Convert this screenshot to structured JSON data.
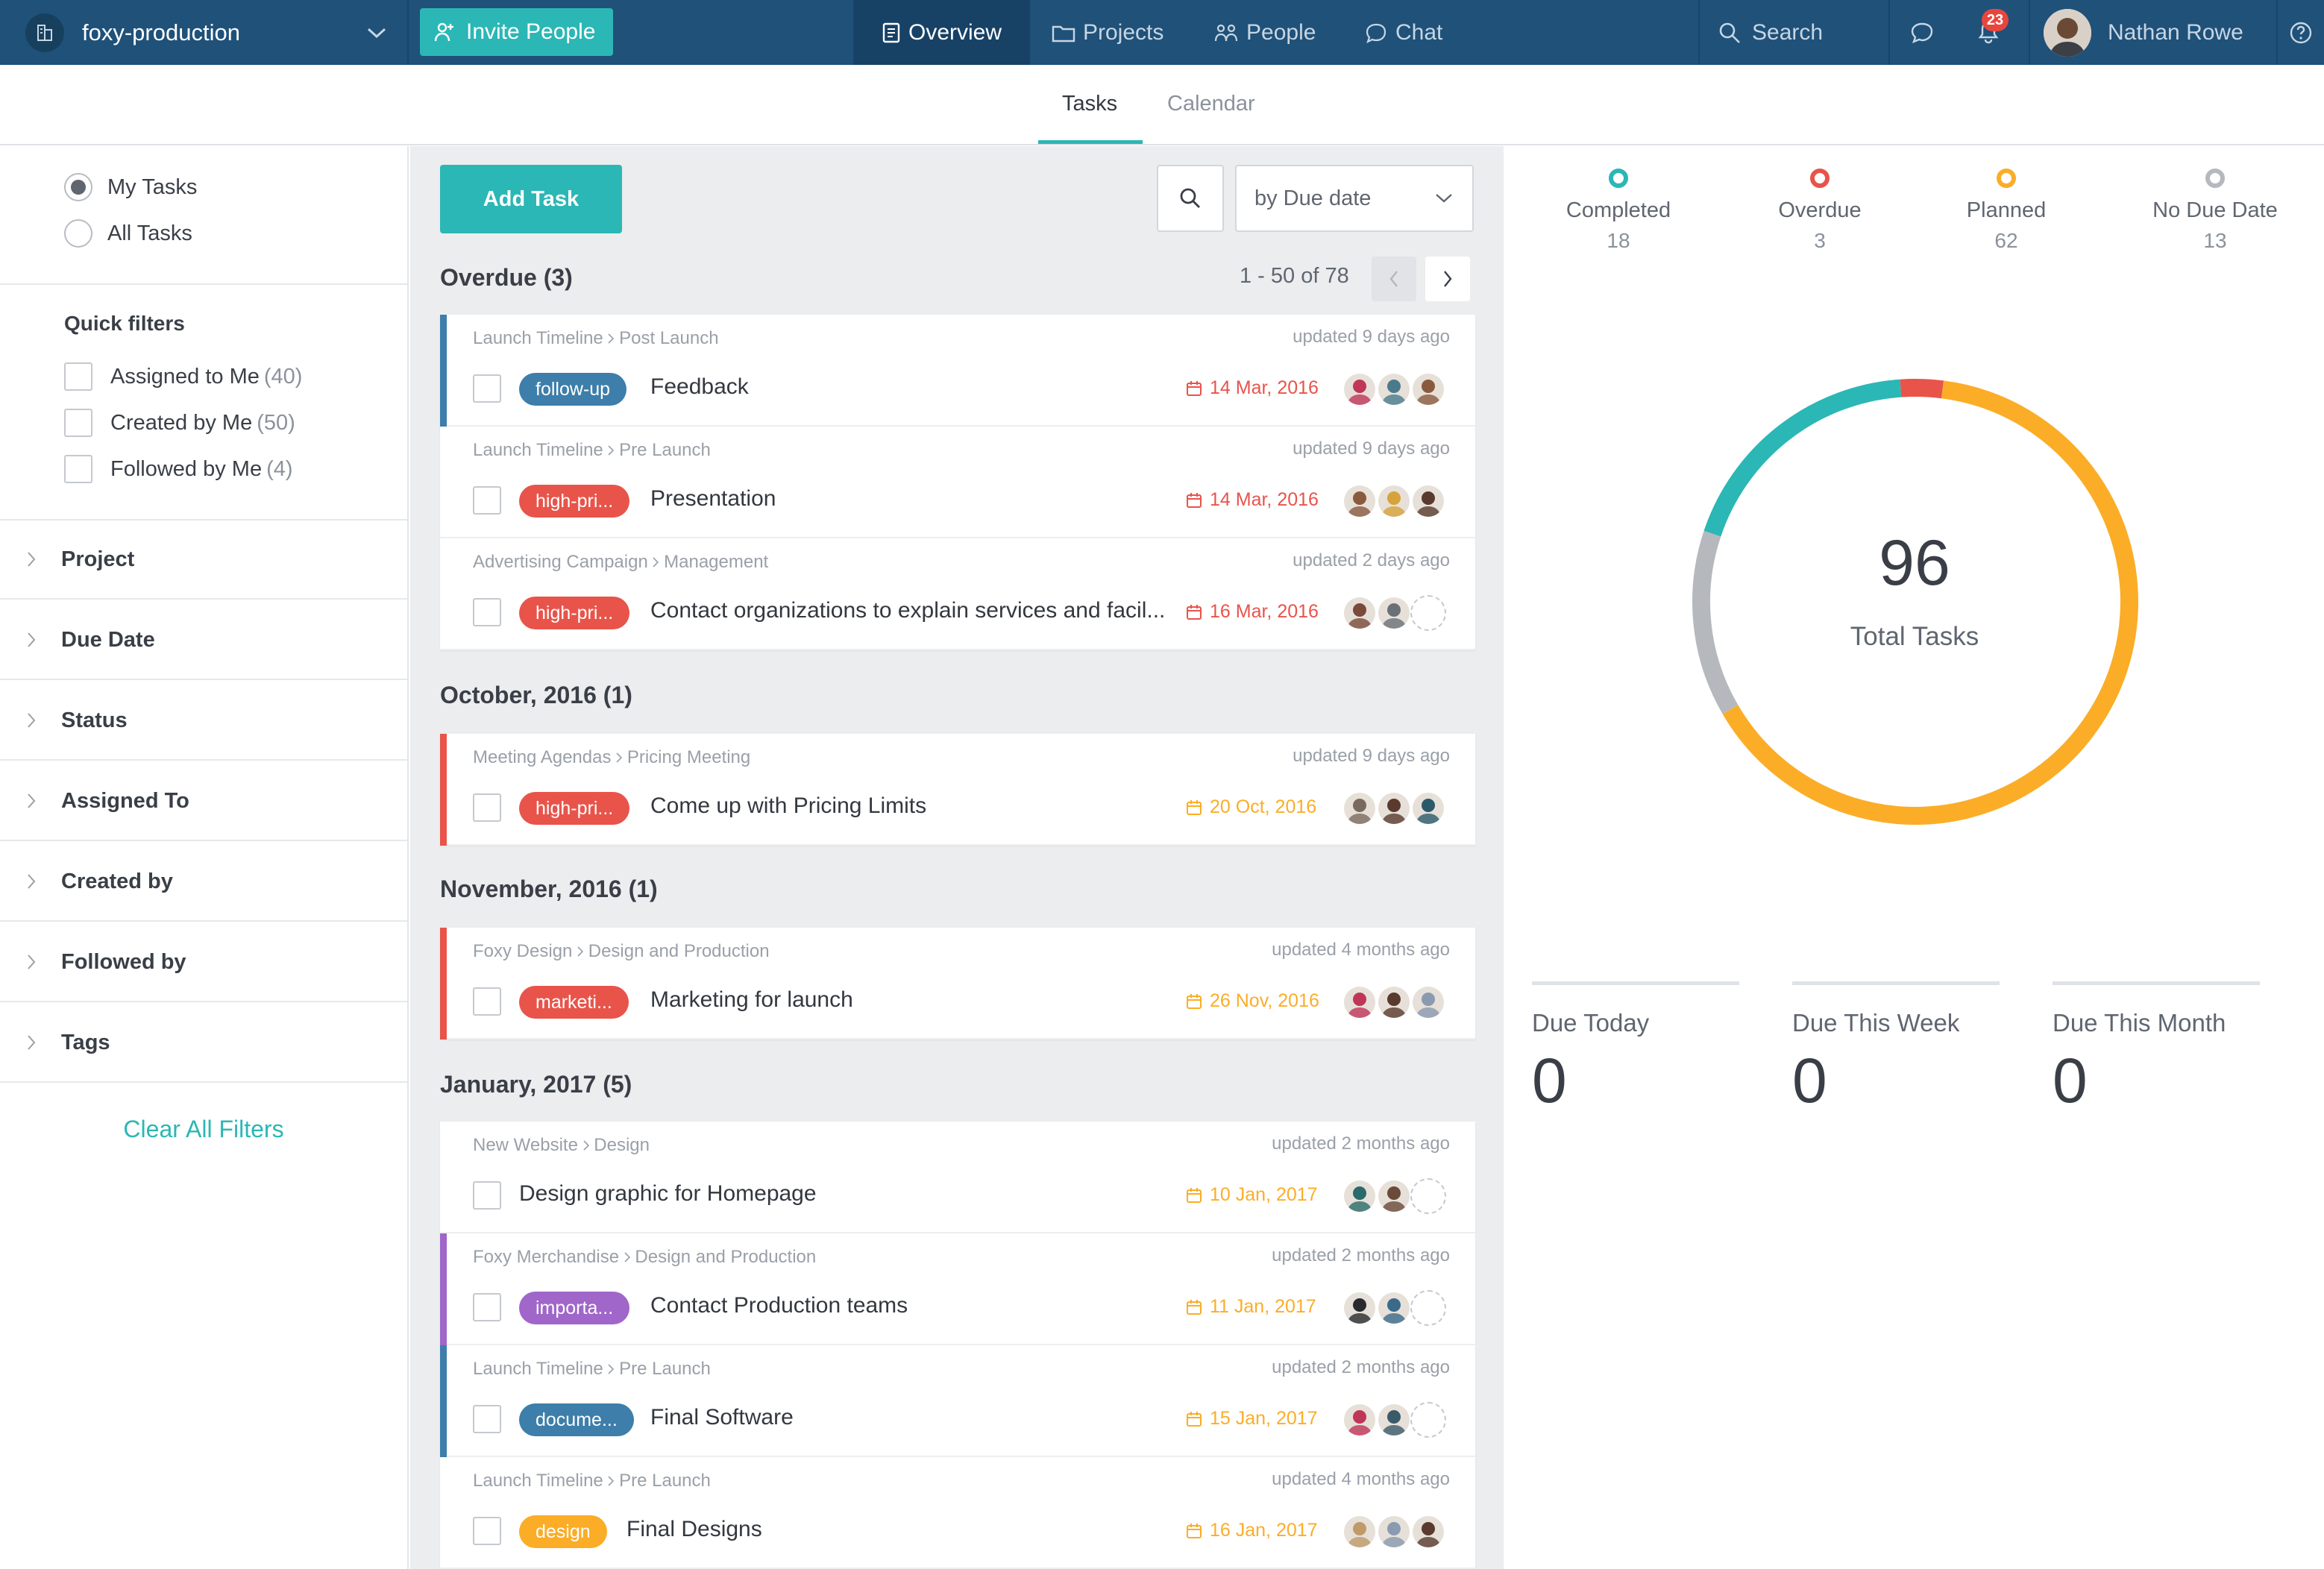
{
  "topbar": {
    "workspace": "foxy-production",
    "invite_label": "Invite People",
    "nav": [
      {
        "label": "Overview"
      },
      {
        "label": "Projects"
      },
      {
        "label": "People"
      },
      {
        "label": "Chat"
      }
    ],
    "search_label": "Search",
    "notification_count": "23",
    "user_name": "Nathan Rowe"
  },
  "tabs": {
    "tasks": "Tasks",
    "calendar": "Calendar"
  },
  "sidebar": {
    "scope": [
      "My Tasks",
      "All Tasks"
    ],
    "quick_filters_title": "Quick filters",
    "quick_filters": [
      {
        "label": "Assigned to Me",
        "count": "(40)"
      },
      {
        "label": "Created by Me",
        "count": "(50)"
      },
      {
        "label": "Followed by Me",
        "count": "(4)"
      }
    ],
    "filters": [
      "Project",
      "Due Date",
      "Status",
      "Assigned To",
      "Created by",
      "Followed by",
      "Tags"
    ],
    "clear_label": "Clear All Filters"
  },
  "main": {
    "add_task": "Add Task",
    "sort_label": "by Due date",
    "pager": "1 - 50 of 78",
    "sections": [
      {
        "title": "Overdue (3)"
      },
      {
        "title": "October, 2016 (1)"
      },
      {
        "title": "November, 2016 (1)"
      },
      {
        "title": "January, 2017 (5)"
      }
    ],
    "tasks": [
      {
        "crumb_a": "Launch Timeline",
        "crumb_b": "Post Launch",
        "updated": "updated 9 days ago",
        "tag": "follow-up",
        "title": "Feedback",
        "due": "14 Mar, 2016"
      },
      {
        "crumb_a": "Launch Timeline",
        "crumb_b": "Pre Launch",
        "updated": "updated 9 days ago",
        "tag": "high-pri...",
        "title": "Presentation",
        "due": "14 Mar, 2016"
      },
      {
        "crumb_a": "Advertising Campaign",
        "crumb_b": "Management",
        "updated": "updated 2 days ago",
        "tag": "high-pri...",
        "title": "Contact organizations to explain services and facil...",
        "due": "16 Mar, 2016"
      },
      {
        "crumb_a": "Meeting Agendas",
        "crumb_b": "Pricing Meeting",
        "updated": "updated 9 days ago",
        "tag": "high-pri...",
        "title": "Come up with Pricing Limits",
        "due": "20 Oct, 2016"
      },
      {
        "crumb_a": "Foxy Design",
        "crumb_b": "Design and Production",
        "updated": "updated 4 months ago",
        "tag": "marketi...",
        "title": "Marketing for launch",
        "due": "26 Nov, 2016"
      },
      {
        "crumb_a": "New Website",
        "crumb_b": "Design",
        "updated": "updated 2 months ago",
        "tag": "",
        "title": "Design graphic for Homepage",
        "due": "10 Jan, 2017"
      },
      {
        "crumb_a": "Foxy Merchandise",
        "crumb_b": "Design and Production",
        "updated": "updated 2 months ago",
        "tag": "importa...",
        "title": "Contact Production teams",
        "due": "11 Jan, 2017"
      },
      {
        "crumb_a": "Launch Timeline",
        "crumb_b": "Pre Launch",
        "updated": "updated 2 months ago",
        "tag": "docume...",
        "title": "Final Software",
        "due": "15 Jan, 2017"
      },
      {
        "crumb_a": "Launch Timeline",
        "crumb_b": "Pre Launch",
        "updated": "updated 4 months ago",
        "tag": "design",
        "title": "Final Designs",
        "due": "16 Jan, 2017"
      }
    ]
  },
  "stats": {
    "completed": {
      "label": "Completed",
      "value": "18",
      "color": "#2bb7b5"
    },
    "overdue": {
      "label": "Overdue",
      "value": "3",
      "color": "#e8544a"
    },
    "planned": {
      "label": "Planned",
      "value": "62",
      "color": "#fbad27"
    },
    "nodue": {
      "label": "No Due Date",
      "value": "13",
      "color": "#b5b9be"
    },
    "total": "96",
    "total_label": "Total Tasks"
  },
  "due": {
    "today": {
      "label": "Due Today",
      "value": "0"
    },
    "week": {
      "label": "Due This Week",
      "value": "0"
    },
    "month": {
      "label": "Due This Month",
      "value": "0"
    }
  },
  "colors": {
    "teal": "#2bb7b5",
    "red": "#e8544a",
    "orange": "#fbad27",
    "blue": "#3d7eaa",
    "purple": "#a066c9",
    "navy": "#1f5179"
  }
}
